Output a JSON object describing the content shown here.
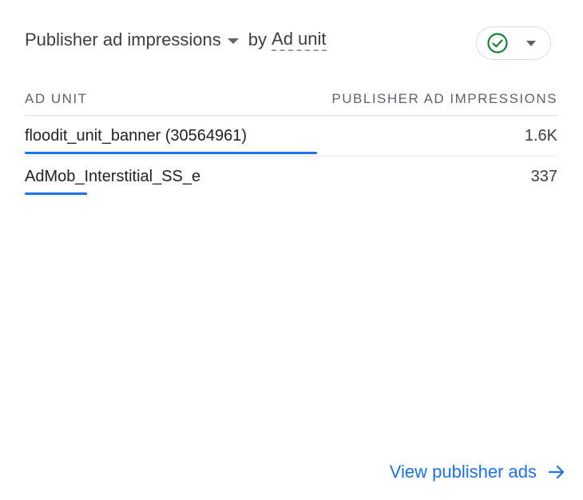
{
  "header": {
    "metric_label": "Publisher ad impressions",
    "by_label": "by",
    "dimension_label": "Ad unit",
    "status_icon": "check-circle-icon",
    "status_color": "#188038"
  },
  "table": {
    "col_dimension": "AD UNIT",
    "col_metric": "PUBLISHER AD IMPRESSIONS",
    "rows": [
      {
        "name": "floodit_unit_banner (30564961)",
        "value": "1.6K",
        "share": 0.824
      },
      {
        "name": "AdMob_Interstitial_SS_e",
        "value": "337",
        "share": 0.176
      }
    ],
    "bar_color": "#1a73e8"
  },
  "footer": {
    "link_label": "View publisher ads",
    "link_icon": "arrow-right-icon"
  }
}
